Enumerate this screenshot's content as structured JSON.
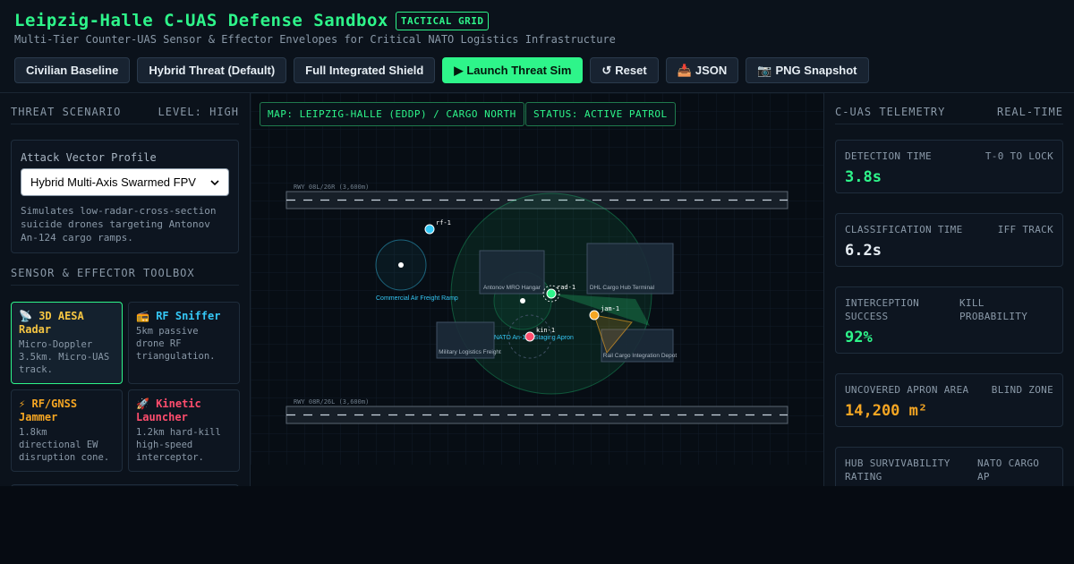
{
  "header": {
    "title": "Leipzig-Halle C-UAS Defense Sandbox",
    "tag": "TACTICAL GRID",
    "subtitle": "Multi-Tier Counter-UAS Sensor & Effector Envelopes for Critical NATO Logistics Infrastructure"
  },
  "toolbar": [
    {
      "label": "Civilian Baseline",
      "icon": "",
      "primary": false
    },
    {
      "label": "Hybrid Threat (Default)",
      "icon": "",
      "primary": false
    },
    {
      "label": "Full Integrated Shield",
      "icon": "",
      "primary": false
    },
    {
      "label": "Launch Threat Sim",
      "icon": "▶",
      "primary": true
    },
    {
      "label": "Reset",
      "icon": "↺",
      "primary": false
    },
    {
      "label": "JSON",
      "icon": "📥",
      "primary": false
    },
    {
      "label": "PNG Snapshot",
      "icon": "📷",
      "primary": false
    }
  ],
  "left": {
    "scenario_title": "THREAT SCENARIO",
    "level": "LEVEL: HIGH",
    "attack_label": "Attack Vector Profile",
    "attack_selected": "Hybrid Multi-Axis Swarmed FPV",
    "attack_desc": "Simulates low-radar-cross-section suicide drones targeting Antonov An-124 cargo ramps.",
    "toolbox_title": "SENSOR & EFFECTOR TOOLBOX",
    "tools": [
      {
        "icon": "📡",
        "name": "3D AESA Radar",
        "desc": "Micro-Doppler 3.5km. Micro-UAS track.",
        "color": "#f5c542",
        "active": true
      },
      {
        "icon": "📻",
        "name": "RF Sniffer",
        "desc": "5km passive drone RF triangulation.",
        "color": "#35c7f5",
        "active": false
      },
      {
        "icon": "⚡",
        "name": "RF/GNSS Jammer",
        "desc": "1.8km directional EW disruption cone.",
        "color": "#f5a623",
        "active": false
      },
      {
        "icon": "🚀",
        "name": "Kinetic Launcher",
        "desc": "1.2km hard-kill high-speed interceptor.",
        "color": "#ff4d6d",
        "active": false
      }
    ]
  },
  "map": {
    "map_badge": "MAP: LEIPZIG-HALLE (EDDP) / CARGO NORTH",
    "status_badge": "STATUS: ACTIVE PATROL",
    "runway_north": "RWY 08L/26R (3,600m)",
    "runway_south": "RWY 08R/26L (3,600m)",
    "zones": {
      "mro": "Antonov MRO Hangar",
      "dhl": "DHL Cargo Hub Terminal",
      "military": "Military Logistics Freight",
      "rail": "Rail Cargo Integration Depot",
      "ramp": "Commercial Air Freight Ramp",
      "apron": "NATO An-124 Staging Apron"
    },
    "units": {
      "rf": "rf-1",
      "rad": "rad-1",
      "jam": "jam-1",
      "kin": "kin-1"
    }
  },
  "right": {
    "title": "C-UAS TELEMETRY",
    "mode": "REAL-TIME",
    "metrics": [
      {
        "label": "DETECTION TIME",
        "sub": "T-0 TO LOCK",
        "value": "3.8s",
        "color": "#2ef58a"
      },
      {
        "label": "CLASSIFICATION TIME",
        "sub": "IFF TRACK",
        "value": "6.2s",
        "color": "#e6edf3"
      },
      {
        "label": "INTERCEPTION SUCCESS",
        "sub": "KILL PROBABILITY",
        "value": "92%",
        "color": "#2ef58a"
      },
      {
        "label": "UNCOVERED APRON AREA",
        "sub": "BLIND ZONE",
        "value": "14,200 m²",
        "color": "#f5a623"
      },
      {
        "label": "HUB SURVIVABILITY RATING",
        "sub": "NATO CARGO AP",
        "value": "",
        "color": "#e6edf3"
      }
    ]
  }
}
